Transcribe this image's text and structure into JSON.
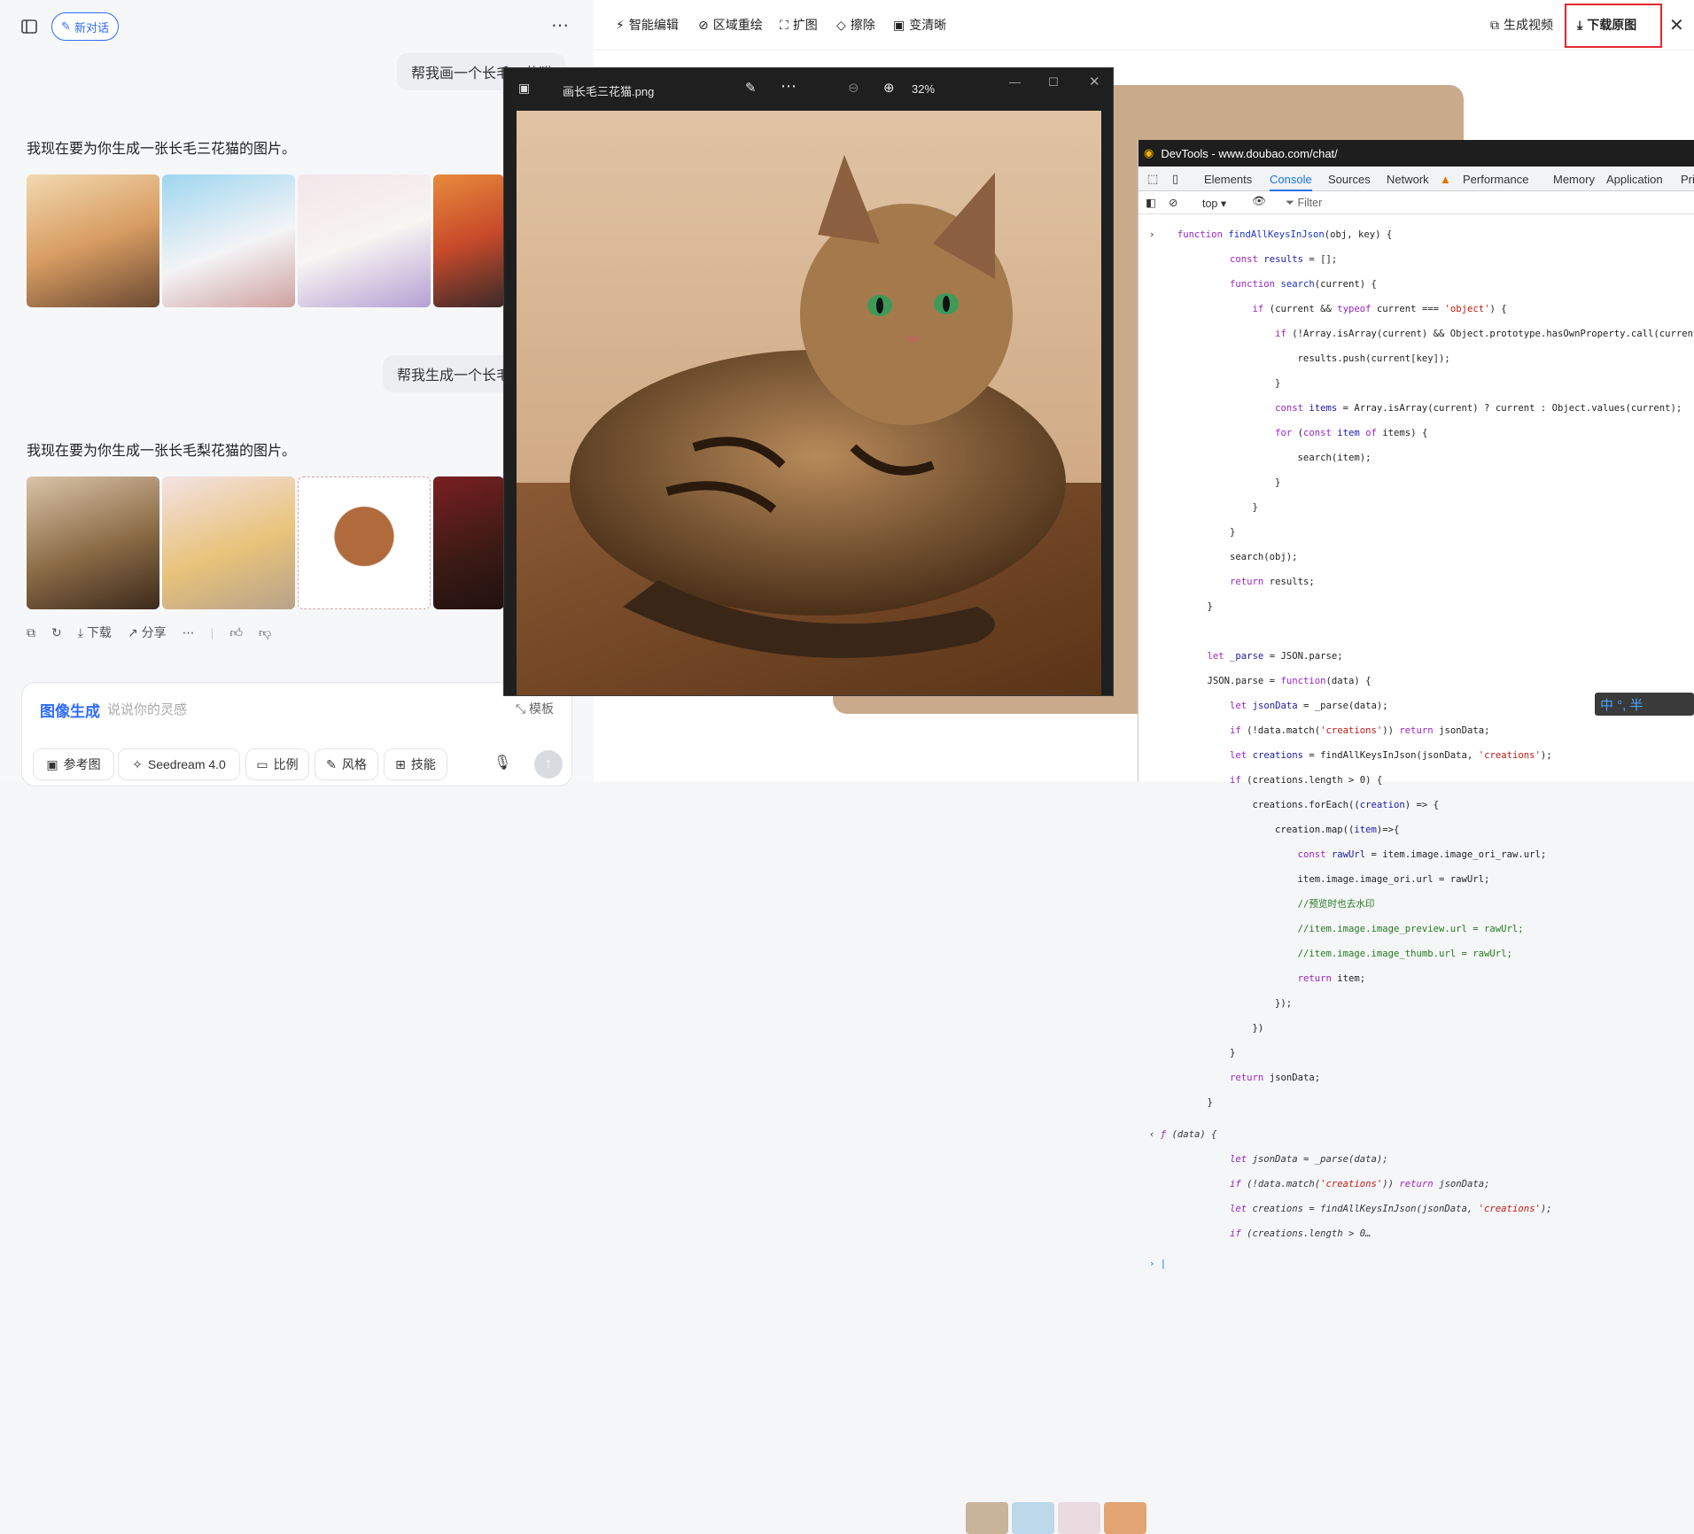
{
  "left": {
    "new_chat": "新对话",
    "msg1_user": "帮我画一个长毛三花猫",
    "msg1_reply": "我现在要为你生成一张长毛三花猫的图片。",
    "msg2_user": "帮我生成一个长毛梨花猫",
    "msg2_reply": "我现在要为你生成一张长毛梨花猫的图片。",
    "actions": [
      "下载",
      "分享"
    ],
    "input": {
      "mode": "图像生成",
      "placeholder": "说说你的灵感",
      "template": "模板",
      "chips": [
        "参考图",
        "Seedream 4.0",
        "比例",
        "风格",
        "技能"
      ]
    }
  },
  "toolbar": {
    "smart_edit": "智能编辑",
    "region_redraw": "区域重绘",
    "expand": "扩图",
    "erase": "擦除",
    "sharpen": "变清晰",
    "gen_video": "生成视频",
    "download_original": "下载原图"
  },
  "viewer": {
    "filename": "画长毛三花猫.png",
    "zoom": "32%"
  },
  "devtools": {
    "title": "DevTools - www.doubao.com/chat/",
    "tabs": [
      "Elements",
      "Console",
      "Sources",
      "Network",
      "Performance",
      "Memory",
      "Application",
      "Pri"
    ],
    "active_tab": "Console",
    "context": "top",
    "filter": "Filter"
  },
  "ime": "中 °, 半"
}
